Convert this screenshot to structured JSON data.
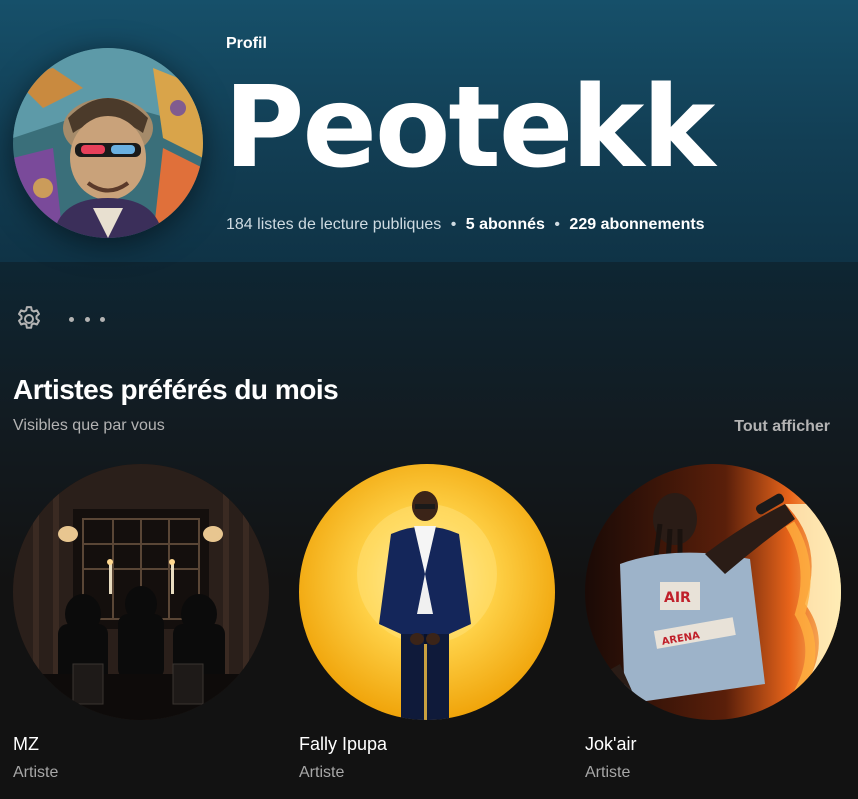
{
  "profile": {
    "type_label": "Profil",
    "name": "Peotekk",
    "stats": {
      "playlists": "184 listes de lecture publiques",
      "followers": "5 abonnés",
      "following": "229 abonnements",
      "separator": "•"
    }
  },
  "actions": {
    "settings_icon": "gear-icon",
    "more_icon": "more-horizontal-icon"
  },
  "top_artists": {
    "title": "Artistes préférés du mois",
    "subtitle": "Visibles que par vous",
    "show_all": "Tout afficher",
    "items": [
      {
        "name": "MZ",
        "type": "Artiste"
      },
      {
        "name": "Fally Ipupa",
        "type": "Artiste"
      },
      {
        "name": "Jok'air",
        "type": "Artiste"
      }
    ]
  },
  "colors": {
    "header_bg": "#16506a",
    "page_bg": "#121212",
    "muted_text": "#b3b3b3",
    "accent_yellow": "#f5b40f"
  }
}
